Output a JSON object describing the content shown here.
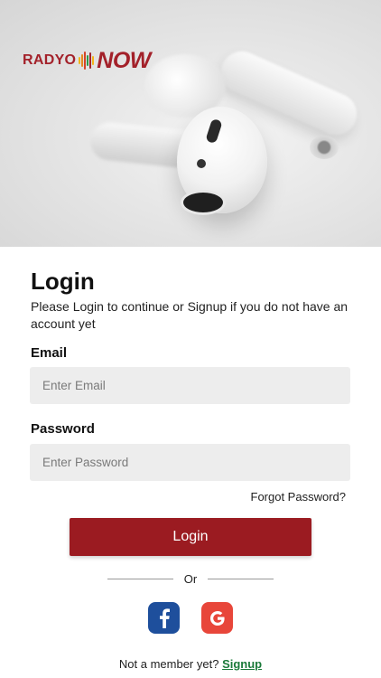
{
  "brand": {
    "logo_left": "RADYO",
    "logo_right": "NOW",
    "color": "#a3212a"
  },
  "login": {
    "title": "Login",
    "subtitle": "Please Login to continue or Signup if you do not have an account yet",
    "email_label": "Email",
    "email_placeholder": "Enter Email",
    "email_value": "",
    "password_label": "Password",
    "password_placeholder": "Enter Password",
    "password_value": "",
    "forgot_label": "Forgot Password?",
    "button_label": "Login",
    "button_color": "#9b1b21"
  },
  "divider": {
    "label": "Or"
  },
  "social": {
    "facebook_icon": "facebook-icon",
    "google_icon": "google-icon"
  },
  "footer": {
    "prompt": "Not a member yet?",
    "signup_label": "Signup",
    "signup_color": "#1b7a3a"
  }
}
